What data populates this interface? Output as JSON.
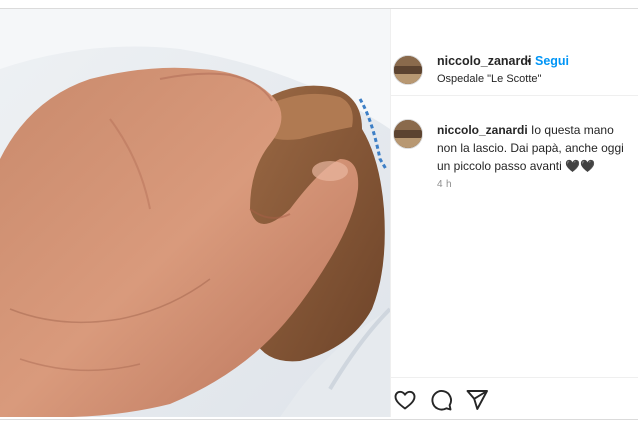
{
  "post": {
    "username": "niccolo_zanardi",
    "separator": "•",
    "follow_label": "Segui",
    "location": "Ospedale \"Le Scotte\"",
    "caption_username": "niccolo_zanardi",
    "caption_text": "Io questa mano non la lascio. Dai papà, anche oggi un piccolo passo avanti 🖤🖤",
    "timestamp": "4 h"
  },
  "icons": {
    "like": "heart-icon",
    "comment": "speech-bubble-icon",
    "share": "paper-plane-icon"
  },
  "colors": {
    "follow": "#0095f6",
    "text": "#262626",
    "muted": "#8e8e8e"
  }
}
